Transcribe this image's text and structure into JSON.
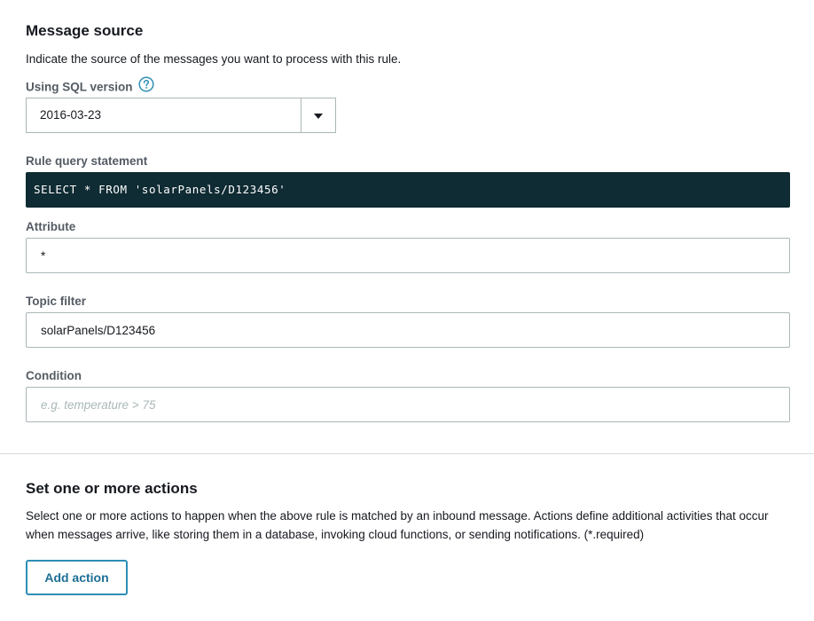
{
  "message_source": {
    "title": "Message source",
    "description": "Indicate the source of the messages you want to process with this rule.",
    "sql_version": {
      "label": "Using SQL version",
      "help_icon": "question-circle-icon",
      "selected_value": "2016-03-23",
      "dropdown_icon": "caret-down-icon"
    },
    "rule_query": {
      "label": "Rule query statement",
      "statement": "SELECT * FROM 'solarPanels/D123456'"
    },
    "attribute": {
      "label": "Attribute",
      "value": "*"
    },
    "topic_filter": {
      "label": "Topic filter",
      "value": "solarPanels/D123456"
    },
    "condition": {
      "label": "Condition",
      "value": "",
      "placeholder": "e.g. temperature > 75"
    }
  },
  "actions": {
    "title": "Set one or more actions",
    "description_line1": "Select one or more actions to happen when the above rule is matched by an inbound message. Actions define additional activities that occur",
    "description_line2": "when messages arrive, like storing them in a database, invoking cloud functions, or sending notifications. (*.required)",
    "add_action_label": "Add action"
  },
  "colors": {
    "accent": "#2e8eb4",
    "code_background": "#0f2b33",
    "label_gray": "#545b64",
    "border": "#aab7b8"
  }
}
